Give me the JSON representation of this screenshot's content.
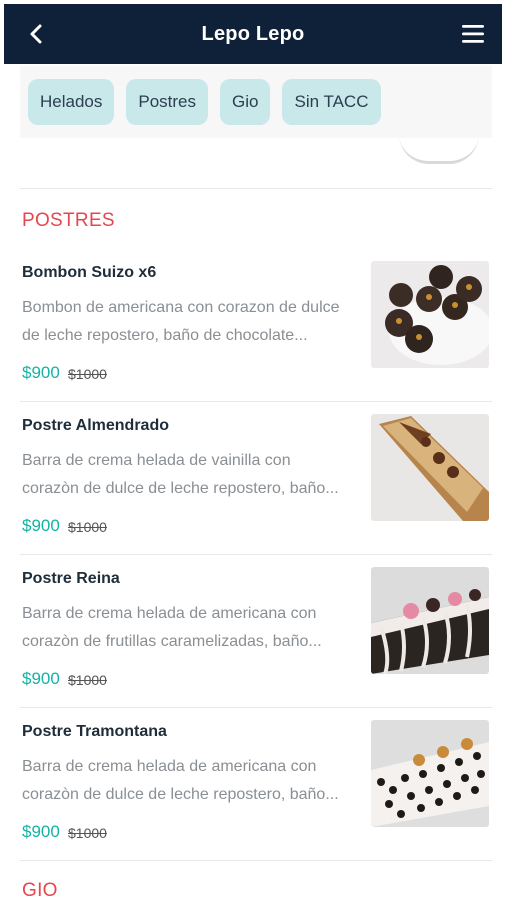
{
  "header": {
    "title": "Lepo Lepo",
    "back_icon": "chevron-left-icon",
    "menu_icon": "hamburger-menu-icon"
  },
  "categories": [
    "Helados",
    "Postres",
    "Gio",
    "Sin TACC"
  ],
  "sections": [
    {
      "title": "POSTRES",
      "items": [
        {
          "name": "Bombon Suizo x6",
          "desc_line1": "Bombon de americana con corazon de dulce",
          "desc_line2": "de leche repostero, baño de chocolate...",
          "price": "$900",
          "old_price": "$1000"
        },
        {
          "name": "Postre Almendrado",
          "desc_line1": "Barra de crema helada de vainilla con",
          "desc_line2": "corazòn de dulce de leche repostero, baño...",
          "price": "$900",
          "old_price": "$1000"
        },
        {
          "name": "Postre Reina",
          "desc_line1": "Barra de crema helada de americana con",
          "desc_line2": "corazòn de frutillas caramelizadas, baño...",
          "price": "$900",
          "old_price": "$1000"
        },
        {
          "name": "Postre Tramontana",
          "desc_line1": "Barra de crema helada de americana con",
          "desc_line2": "corazòn de dulce de leche repostero, baño...",
          "price": "$900",
          "old_price": "$1000"
        }
      ]
    },
    {
      "title": "GIO"
    }
  ],
  "colors": {
    "header_bg": "#0f2138",
    "chip_bg": "#c9e8ea",
    "section_title": "#e4474f",
    "price": "#15b3a3"
  }
}
